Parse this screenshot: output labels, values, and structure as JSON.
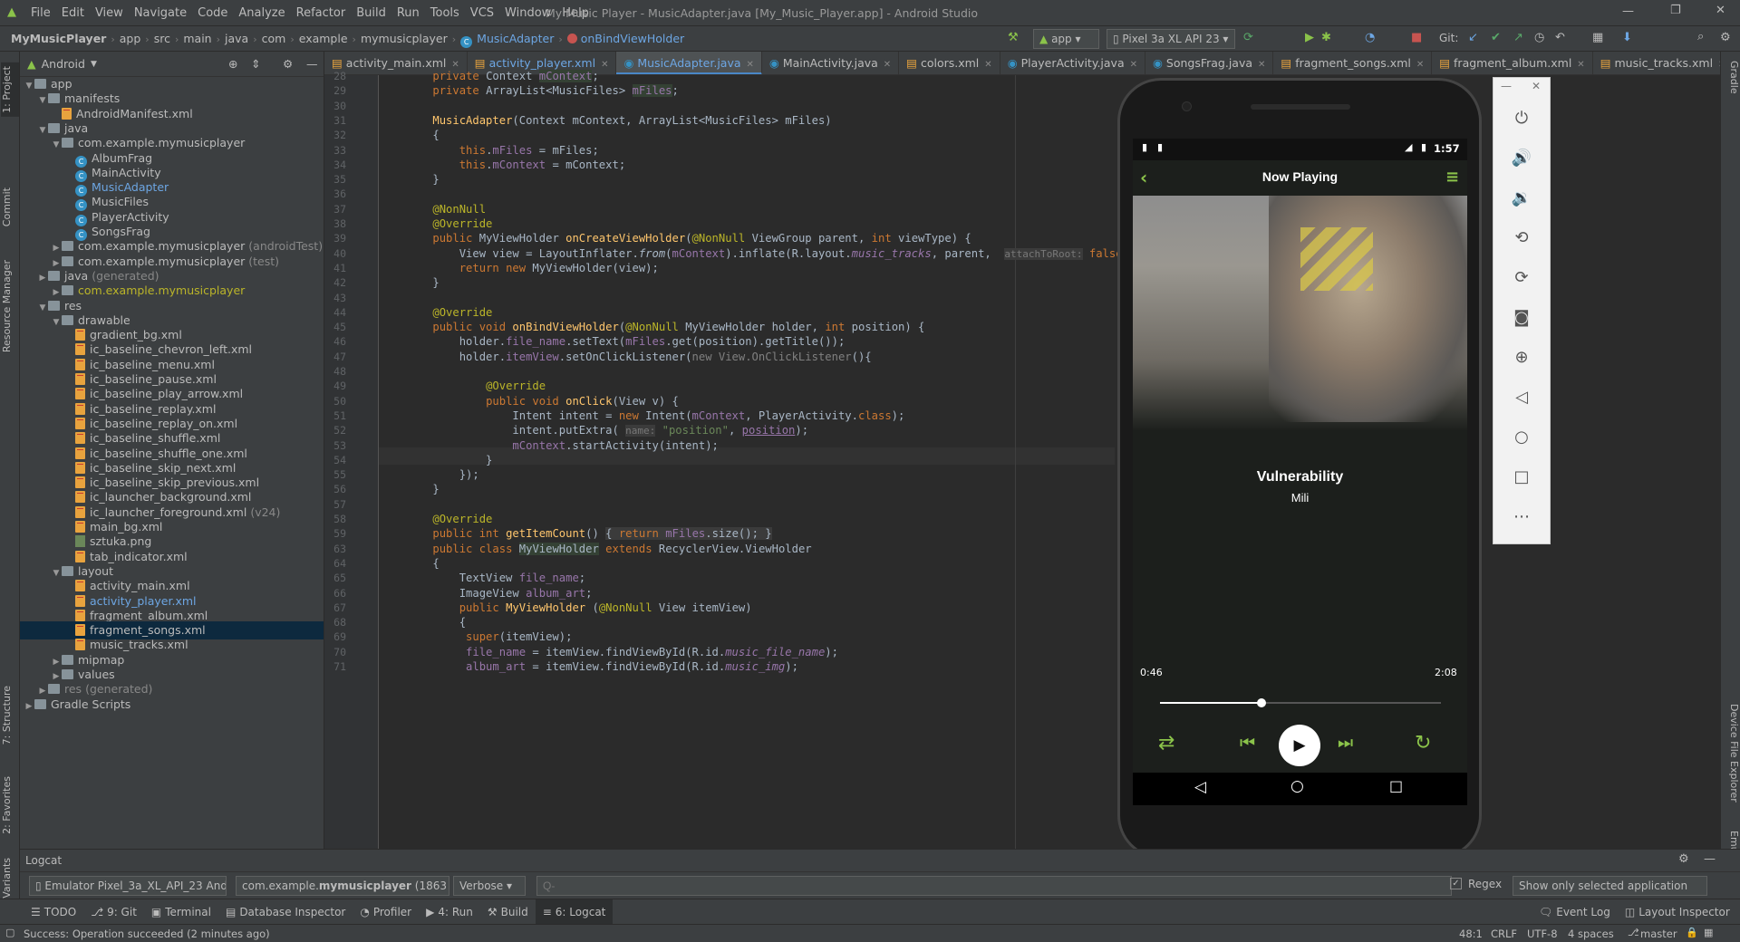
{
  "window": {
    "title": "My Music Player - MusicAdapter.java [My_Music_Player.app] - Android Studio"
  },
  "menu": [
    "File",
    "Edit",
    "View",
    "Navigate",
    "Code",
    "Analyze",
    "Refactor",
    "Build",
    "Run",
    "Tools",
    "VCS",
    "Window",
    "Help"
  ],
  "breadcrumb": [
    "MyMusicPlayer",
    "app",
    "src",
    "main",
    "java",
    "com",
    "example",
    "mymusicplayer",
    "MusicAdapter",
    "onBindViewHolder"
  ],
  "toolbar": {
    "run_config": "app",
    "device": "Pixel 3a XL API 23",
    "git_label": "Git:"
  },
  "project_panel": {
    "view_mode": "Android",
    "tree": [
      {
        "label": "app",
        "type": "folder",
        "depth": 0
      },
      {
        "label": "manifests",
        "type": "folder",
        "depth": 1
      },
      {
        "label": "AndroidManifest.xml",
        "type": "xml",
        "depth": 2
      },
      {
        "label": "java",
        "type": "folder",
        "depth": 1
      },
      {
        "label": "com.example.mymusicplayer",
        "type": "pkg",
        "depth": 2
      },
      {
        "label": "AlbumFrag",
        "type": "class",
        "depth": 3
      },
      {
        "label": "MainActivity",
        "type": "class",
        "depth": 3
      },
      {
        "label": "MusicAdapter",
        "type": "class",
        "depth": 3,
        "color": "#6da6e3"
      },
      {
        "label": "MusicFiles",
        "type": "class",
        "depth": 3
      },
      {
        "label": "PlayerActivity",
        "type": "class",
        "depth": 3
      },
      {
        "label": "SongsFrag",
        "type": "class",
        "depth": 3
      },
      {
        "label": "com.example.mymusicplayer",
        "suffix": "(androidTest)",
        "type": "pkg",
        "depth": 2
      },
      {
        "label": "com.example.mymusicplayer",
        "suffix": "(test)",
        "type": "pkg",
        "depth": 2
      },
      {
        "label": "java",
        "suffix": "(generated)",
        "type": "folder",
        "depth": 1
      },
      {
        "label": "com.example.mymusicplayer",
        "type": "pkg",
        "depth": 2,
        "color": "#bbb529"
      },
      {
        "label": "res",
        "type": "folder",
        "depth": 1
      },
      {
        "label": "drawable",
        "type": "folder",
        "depth": 2
      },
      {
        "label": "gradient_bg.xml",
        "type": "xml",
        "depth": 3
      },
      {
        "label": "ic_baseline_chevron_left.xml",
        "type": "xml",
        "depth": 3
      },
      {
        "label": "ic_baseline_menu.xml",
        "type": "xml",
        "depth": 3
      },
      {
        "label": "ic_baseline_pause.xml",
        "type": "xml",
        "depth": 3
      },
      {
        "label": "ic_baseline_play_arrow.xml",
        "type": "xml",
        "depth": 3
      },
      {
        "label": "ic_baseline_replay.xml",
        "type": "xml",
        "depth": 3
      },
      {
        "label": "ic_baseline_replay_on.xml",
        "type": "xml",
        "depth": 3
      },
      {
        "label": "ic_baseline_shuffle.xml",
        "type": "xml",
        "depth": 3
      },
      {
        "label": "ic_baseline_shuffle_one.xml",
        "type": "xml",
        "depth": 3
      },
      {
        "label": "ic_baseline_skip_next.xml",
        "type": "xml",
        "depth": 3
      },
      {
        "label": "ic_baseline_skip_previous.xml",
        "type": "xml",
        "depth": 3
      },
      {
        "label": "ic_launcher_background.xml",
        "type": "xml",
        "depth": 3
      },
      {
        "label": "ic_launcher_foreground.xml",
        "suffix": "(v24)",
        "type": "xml",
        "depth": 3
      },
      {
        "label": "main_bg.xml",
        "type": "xml",
        "depth": 3
      },
      {
        "label": "sztuka.png",
        "type": "img",
        "depth": 3
      },
      {
        "label": "tab_indicator.xml",
        "type": "xml",
        "depth": 3
      },
      {
        "label": "layout",
        "type": "folder",
        "depth": 2
      },
      {
        "label": "activity_main.xml",
        "type": "xml",
        "depth": 3
      },
      {
        "label": "activity_player.xml",
        "type": "xml",
        "depth": 3,
        "color": "#6da6e3"
      },
      {
        "label": "fragment_album.xml",
        "type": "xml",
        "depth": 3
      },
      {
        "label": "fragment_songs.xml",
        "type": "xml",
        "depth": 3,
        "selected": true
      },
      {
        "label": "music_tracks.xml",
        "type": "xml",
        "depth": 3
      },
      {
        "label": "mipmap",
        "type": "folder",
        "depth": 2
      },
      {
        "label": "values",
        "type": "folder",
        "depth": 2
      },
      {
        "label": "res",
        "suffix": "(generated)",
        "type": "folder",
        "depth": 1,
        "muted": true
      },
      {
        "label": "Gradle Scripts",
        "type": "folder",
        "depth": 0
      }
    ]
  },
  "editor_tabs": [
    {
      "label": "activity_main.xml"
    },
    {
      "label": "activity_player.xml",
      "color": "#6da6e3"
    },
    {
      "label": "MusicAdapter.java",
      "active": true
    },
    {
      "label": "MainActivity.java"
    },
    {
      "label": "colors.xml"
    },
    {
      "label": "PlayerActivity.java"
    },
    {
      "label": "SongsFrag.java"
    },
    {
      "label": "fragment_songs.xml"
    },
    {
      "label": "fragment_album.xml"
    },
    {
      "label": "music_tracks.xml"
    }
  ],
  "code_lines": [
    {
      "n": "28",
      "html": "    <span class='kw'>private</span> Context <span class='fld hl'>mContext</span>;"
    },
    {
      "n": "29",
      "html": "    <span class='kw'>private</span> ArrayList&lt;MusicFiles&gt; <span class='fld hl'>mFiles</span>;"
    },
    {
      "n": "30",
      "html": ""
    },
    {
      "n": "31",
      "html": "    <span class='fn'>MusicAdapter</span>(Context mContext, ArrayList&lt;MusicFiles&gt; mFiles)"
    },
    {
      "n": "32",
      "html": "    {"
    },
    {
      "n": "33",
      "html": "        <span class='kw'>this</span>.<span class='fld'>mFiles</span> = mFiles;"
    },
    {
      "n": "34",
      "html": "        <span class='kw'>this</span>.<span class='fld'>mContext</span> = mContext;"
    },
    {
      "n": "35",
      "html": "    }"
    },
    {
      "n": "36",
      "html": ""
    },
    {
      "n": "37",
      "html": "    <span class='an'>@NonNull</span>"
    },
    {
      "n": "38",
      "html": "    <span class='an'>@Override</span>"
    },
    {
      "n": "39",
      "html": "    <span class='kw'>public</span> MyViewHolder <span class='fn'>onCreateViewHolder</span>(<span class='an'>@NonNull</span> ViewGroup parent, <span class='kw'>int</span> viewType) {"
    },
    {
      "n": "40",
      "html": "        View view = LayoutInflater.<i>from</i>(<span class='fld'>mContext</span>).inflate(R.layout.<span class='fld'><i>music_tracks</i></span>, parent,  <span class='hint'>attachToRoot:</span> <span class='kw'>false</span>);"
    },
    {
      "n": "41",
      "html": "        <span class='kw'>return new</span> MyViewHolder(view);"
    },
    {
      "n": "42",
      "html": "    }"
    },
    {
      "n": "43",
      "html": ""
    },
    {
      "n": "44",
      "html": "    <span class='an'>@Override</span>"
    },
    {
      "n": "45",
      "html": "    <span class='kw'>public void</span> <span class='fn'>onBindViewHolder</span>(<span class='an'>@NonNull</span> MyViewHolder holder, <span class='kw'>int</span> position) {"
    },
    {
      "n": "46",
      "html": "        holder.<span class='fld'>file_name</span>.setText(<span class='fld'>mFiles</span>.get(position).getTitle());"
    },
    {
      "n": "47",
      "html": "        holder.<span class='fld'>itemView</span>.setOnClickListener(<span style='color:#808080'>new View.OnClickListener</span>(){"
    },
    {
      "n": "48",
      "html": ""
    },
    {
      "n": "49",
      "html": "            <span class='an'>@Override</span>"
    },
    {
      "n": "50",
      "html": "            <span class='kw'>public void</span> <span class='fn'>onClick</span>(View v) {"
    },
    {
      "n": "51",
      "html": "                Intent intent = <span class='kw'>new</span> Intent(<span class='fld'>mContext</span>, PlayerActivity.<span class='kw'>class</span>);"
    },
    {
      "n": "52",
      "html": "                intent.putExtra( <span class='hint'>name:</span> <span class='str'>\"position\"</span>, <span class='fld' style='text-decoration:underline'>position</span>);"
    },
    {
      "n": "53",
      "html": "                <span class='fld'>mContext</span>.startActivity(intent);"
    },
    {
      "n": "54",
      "html": "            }"
    },
    {
      "n": "55",
      "html": "        });"
    },
    {
      "n": "56",
      "html": "    }"
    },
    {
      "n": "57",
      "html": ""
    },
    {
      "n": "58",
      "html": "    <span class='an'>@Override</span>"
    },
    {
      "n": "59",
      "html": "    <span class='kw'>public int</span> <span class='fn'>getItemCount</span>() <span style='background:#3b3b3b'>{ <span class='kw'>return</span> <span class='fld'>mFiles</span>.size(); }</span>"
    },
    {
      "n": "63",
      "html": "    <span class='kw'>public class</span> <span class='hl'>MyViewHolder</span> <span class='kw'>extends</span> RecyclerView.ViewHolder"
    },
    {
      "n": "64",
      "html": "    {"
    },
    {
      "n": "65",
      "html": "        TextView <span class='fld'>file_name</span>;"
    },
    {
      "n": "66",
      "html": "        ImageView <span class='fld'>album_art</span>;"
    },
    {
      "n": "67",
      "html": "        <span class='kw'>public</span> <span class='fn'>MyViewHolder</span> (<span class='an'>@NonNull</span> View itemView)"
    },
    {
      "n": "68",
      "html": "        {"
    },
    {
      "n": "69",
      "html": "         <span class='kw'>super</span>(itemView);"
    },
    {
      "n": "70",
      "html": "         <span class='fld'>file_name</span> = itemView.findViewById(R.id.<span class='fld'><i>music_file_name</i></span>);"
    },
    {
      "n": "71",
      "html": "         <span class='fld'>album_art</span> = itemView.findViewById(R.id.<span class='fld'><i>music_img</i></span>);"
    }
  ],
  "phone": {
    "status_time": "1:57",
    "header_title": "Now Playing",
    "song_title": "Vulnerability",
    "artist": "Mili",
    "elapsed": "0:46",
    "duration": "2:08",
    "progress": 0.36
  },
  "logcat": {
    "title": "Logcat",
    "device": "Emulator Pixel_3a_XL_API_23 And",
    "process_prefix": "com.example.",
    "process_bold": "mymusicplayer",
    "process_suffix": " (1863",
    "level": "Verbose",
    "search_placeholder": "Q-",
    "regex_label": "Regex",
    "filter": "Show only selected application"
  },
  "bottom_tabs": {
    "left": [
      {
        "icon": "☰",
        "label": "TODO"
      },
      {
        "icon": "⎇",
        "label": "9: Git"
      },
      {
        "icon": "▣",
        "label": "Terminal"
      },
      {
        "icon": "▤",
        "label": "Database Inspector"
      },
      {
        "icon": "◔",
        "label": "Profiler"
      },
      {
        "icon": "▶",
        "label": "4: Run"
      },
      {
        "icon": "⚒",
        "label": "Build"
      },
      {
        "icon": "≡",
        "label": "6: Logcat"
      }
    ],
    "right": [
      {
        "icon": "🗨",
        "label": "Event Log"
      },
      {
        "icon": "◫",
        "label": "Layout Inspector"
      }
    ]
  },
  "status": {
    "message": "Success: Operation succeeded (2 minutes ago)",
    "position": "48:1",
    "line_sep": "CRLF",
    "encoding": "UTF-8",
    "indent": "4 spaces",
    "branch": "master"
  },
  "side_tabs_left": [
    "1: Project",
    "Commit",
    "Resource Manager",
    "7: Structure",
    "2: Favorites",
    "Build Variants"
  ],
  "side_tabs_right": [
    "Gradle",
    "Device File Explorer",
    "Emulator"
  ],
  "colors": {
    "accent": "#8bc34a",
    "editor_bg": "#2b2b2b",
    "panel_bg": "#3c3f41",
    "selection": "#0d293e"
  }
}
